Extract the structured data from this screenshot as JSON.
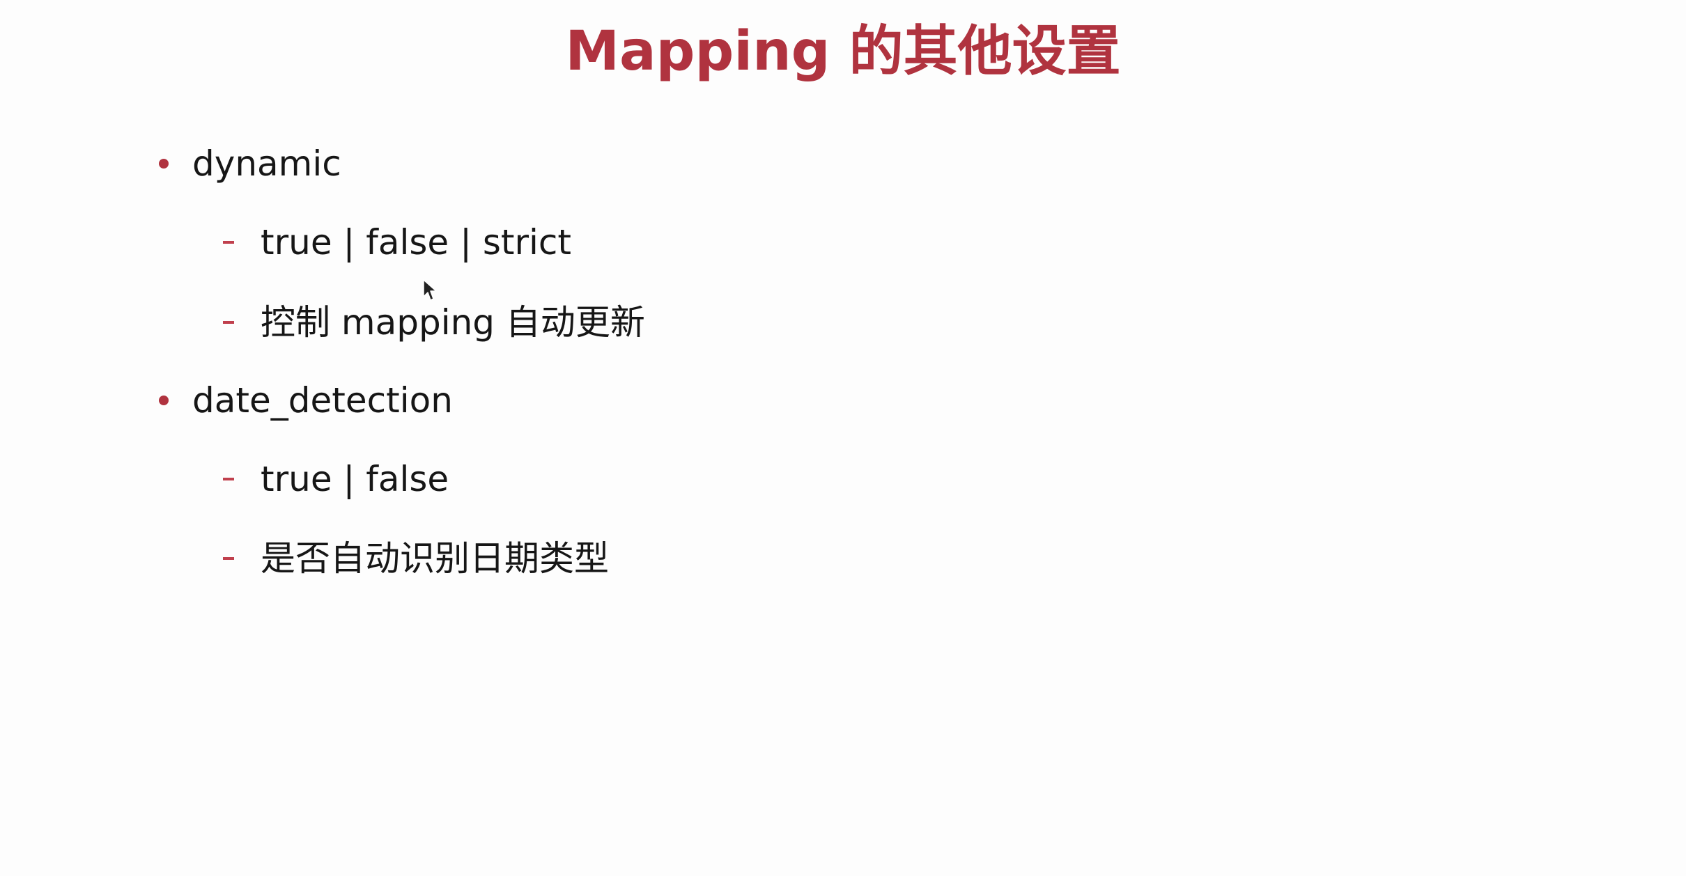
{
  "slide": {
    "title": "Mapping 的其他设置",
    "bullets": [
      {
        "label": "dynamic",
        "sub": [
          "true | false | strict",
          "控制 mapping 自动更新"
        ]
      },
      {
        "label": "date_detection",
        "sub": [
          "true | false",
          "是否自动识别日期类型"
        ]
      }
    ]
  },
  "colors": {
    "accent": "#b0333f",
    "text": "#161616",
    "background": "#fdfdfd"
  },
  "icons": {
    "bullet_level1": "dot",
    "bullet_level2": "dash",
    "cursor": "mouse-pointer-icon"
  }
}
